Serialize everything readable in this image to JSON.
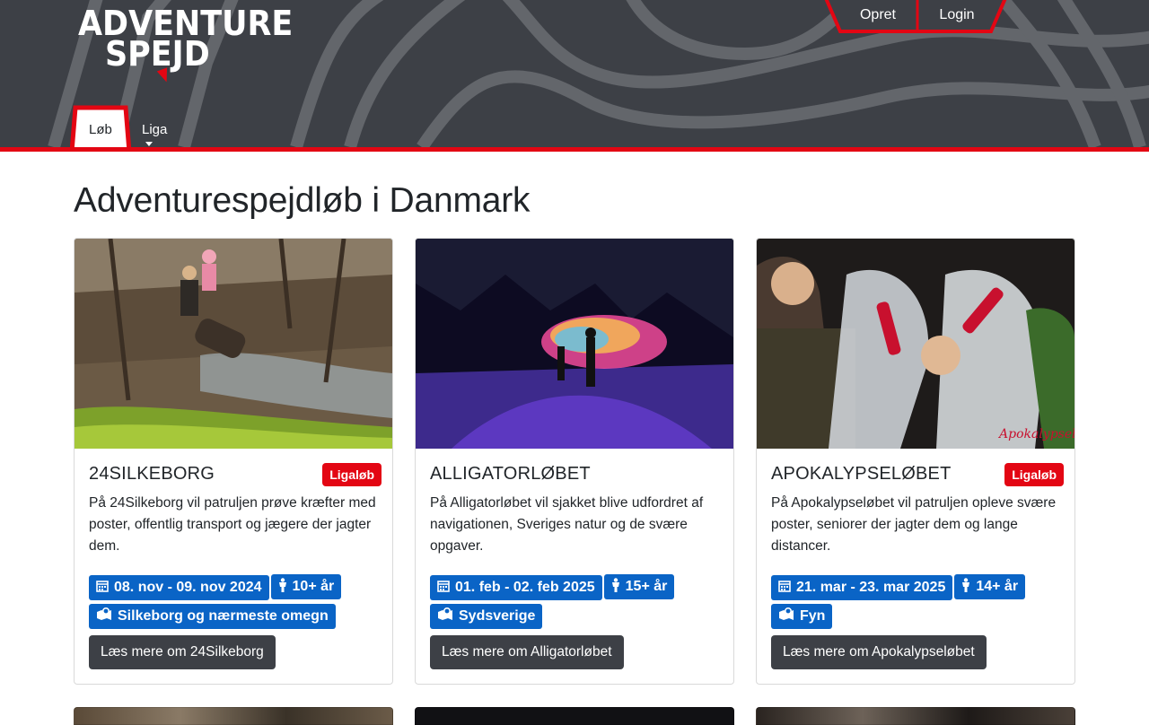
{
  "brand": {
    "line1": "ADVENTURE",
    "line2": "SPEJD",
    "accent": "#e30613",
    "header_bg": "#3d4046"
  },
  "top_nav": {
    "create_label": "Opret",
    "login_label": "Login"
  },
  "tabs": [
    {
      "label": "Løb",
      "active": true
    },
    {
      "label": "Liga",
      "active": false,
      "dropdown": true
    }
  ],
  "page": {
    "title": "Adventurespejdløb i Danmark"
  },
  "races": [
    {
      "title": "24SILKEBORG",
      "liga_badge": "Ligaløb",
      "description": "På 24Silkeborg vil patruljen prøve kræfter med poster, offentlig transport og jægere der jagter dem.",
      "date": "08. nov - 09. nov 2024",
      "age": "10+ år",
      "location": "Silkeborg og nærmeste omegn",
      "button": "Læs mere om 24Silkeborg"
    },
    {
      "title": "ALLIGATORLØBET",
      "liga_badge": "",
      "description": "På Alligatorløbet vil sjakket blive udfordret af navigationen, Sveriges natur og de svære opgaver.",
      "date": "01. feb - 02. feb 2025",
      "age": "15+ år",
      "location": "Sydsverige",
      "button": "Læs mere om Alligatorløbet"
    },
    {
      "title": "APOKALYPSELØBET",
      "liga_badge": "Ligaløb",
      "description": "På Apokalypseløbet vil patruljen opleve svære poster, seniorer der jagter dem og lange distancer.",
      "date": "21. mar - 23. mar 2025",
      "age": "14+ år",
      "location": "Fyn",
      "button": "Læs mere om Apokalypseløbet"
    }
  ],
  "icons": {
    "date": "calendar-icon",
    "age": "person-icon",
    "location": "map-pin-icon"
  },
  "colors": {
    "chip": "#0a64c6",
    "badge": "#e30613",
    "button": "#3d4046"
  }
}
